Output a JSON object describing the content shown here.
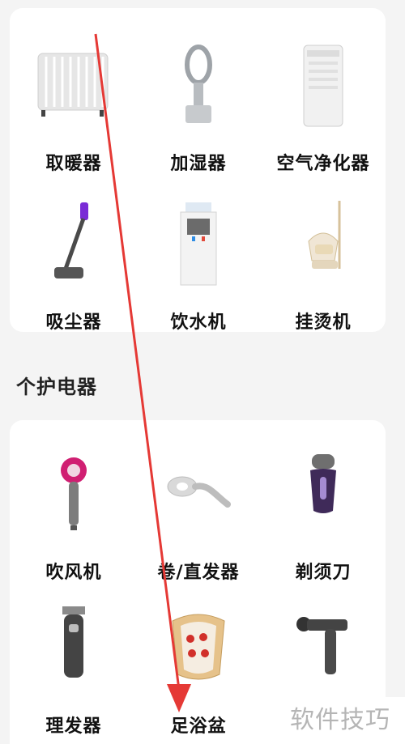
{
  "home_appliances": {
    "items": [
      {
        "label": "取暖器",
        "icon": "heater-icon"
      },
      {
        "label": "加湿器",
        "icon": "humidifier-icon"
      },
      {
        "label": "空气净化器",
        "icon": "air-purifier-icon"
      },
      {
        "label": "吸尘器",
        "icon": "vacuum-cleaner-icon"
      },
      {
        "label": "饮水机",
        "icon": "water-dispenser-icon"
      },
      {
        "label": "挂烫机",
        "icon": "garment-steamer-icon"
      }
    ]
  },
  "personal_care": {
    "title": "个护电器",
    "items": [
      {
        "label": "吹风机",
        "icon": "hair-dryer-icon"
      },
      {
        "label": "卷/直发器",
        "icon": "hair-curler-icon"
      },
      {
        "label": "剃须刀",
        "icon": "shaver-icon"
      },
      {
        "label": "理发器",
        "icon": "hair-clipper-icon"
      },
      {
        "label": "足浴盆",
        "icon": "foot-bath-icon"
      },
      {
        "label": "",
        "icon": "massage-gun-icon"
      }
    ]
  },
  "watermark": {
    "text": "软件技巧"
  },
  "colors": {
    "background": "#f4f4f4",
    "card": "#ffffff",
    "annotation_arrow": "#e53935",
    "watermark": "#b5b5b5"
  }
}
